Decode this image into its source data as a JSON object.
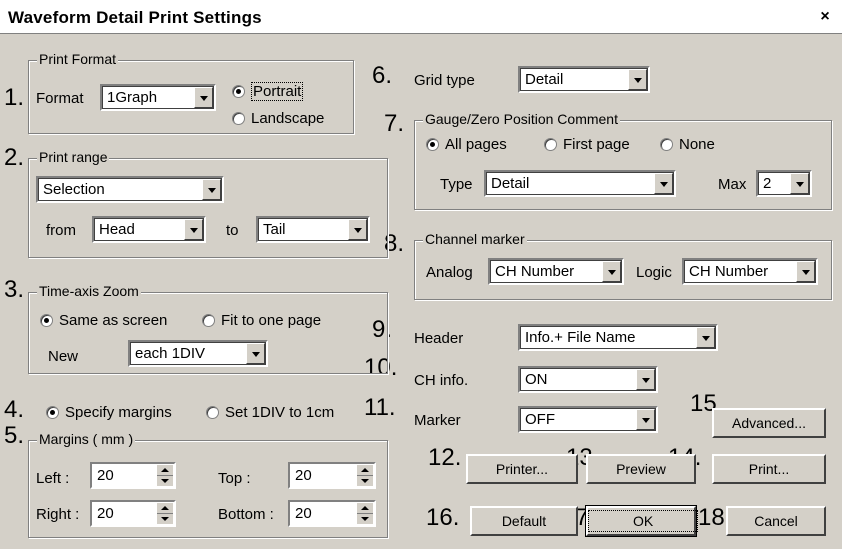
{
  "window": {
    "title": "Waveform Detail Print Settings",
    "close_glyph": "×"
  },
  "markers": [
    "1.",
    "2.",
    "3.",
    "4.",
    "5.",
    "6.",
    "7.",
    "8.",
    "9.",
    "10.",
    "11.",
    "12.",
    "13.",
    "14.",
    "15.",
    "16.",
    "17.",
    "18."
  ],
  "print_format": {
    "legend": "Print Format",
    "format_label": "Format",
    "format_value": "1Graph",
    "orientation": {
      "portrait": "Portrait",
      "landscape": "Landscape",
      "selected": "Portrait"
    }
  },
  "print_range": {
    "legend": "Print range",
    "range_value": "Selection",
    "from_label": "from",
    "from_value": "Head",
    "to_label": "to",
    "to_value": "Tail"
  },
  "time_axis_zoom": {
    "legend": "Time-axis Zoom",
    "same_as_screen": "Same as screen",
    "fit_to_one_page": "Fit to one page",
    "selected": "Same as screen",
    "new_label": "New",
    "new_value": "each 1DIV"
  },
  "margin_mode": {
    "specify": "Specify margins",
    "set_1div": "Set 1DIV to 1cm",
    "selected": "Specify margins"
  },
  "margins": {
    "legend": "Margins ( mm )",
    "left_label": "Left :",
    "left": "20",
    "top_label": "Top :",
    "top": "20",
    "right_label": "Right :",
    "right": "20",
    "bottom_label": "Bottom :",
    "bottom": "20"
  },
  "grid_type": {
    "label": "Grid type",
    "value": "Detail"
  },
  "gauge_comment": {
    "legend": "Gauge/Zero Position Comment",
    "all_pages": "All pages",
    "first_page": "First page",
    "none": "None",
    "selected": "All pages",
    "type_label": "Type",
    "type_value": "Detail",
    "max_label": "Max",
    "max_value": "2"
  },
  "channel_marker": {
    "legend": "Channel marker",
    "analog_label": "Analog",
    "analog_value": "CH Number",
    "logic_label": "Logic",
    "logic_value": "CH Number"
  },
  "header": {
    "label": "Header",
    "value": "Info.+ File Name"
  },
  "ch_info": {
    "label": "CH info.",
    "value": "ON"
  },
  "marker": {
    "label": "Marker",
    "value": "OFF"
  },
  "buttons": {
    "advanced": "Advanced...",
    "printer": "Printer...",
    "preview": "Preview",
    "print": "Print...",
    "default": "Default",
    "ok": "OK",
    "cancel": "Cancel"
  }
}
